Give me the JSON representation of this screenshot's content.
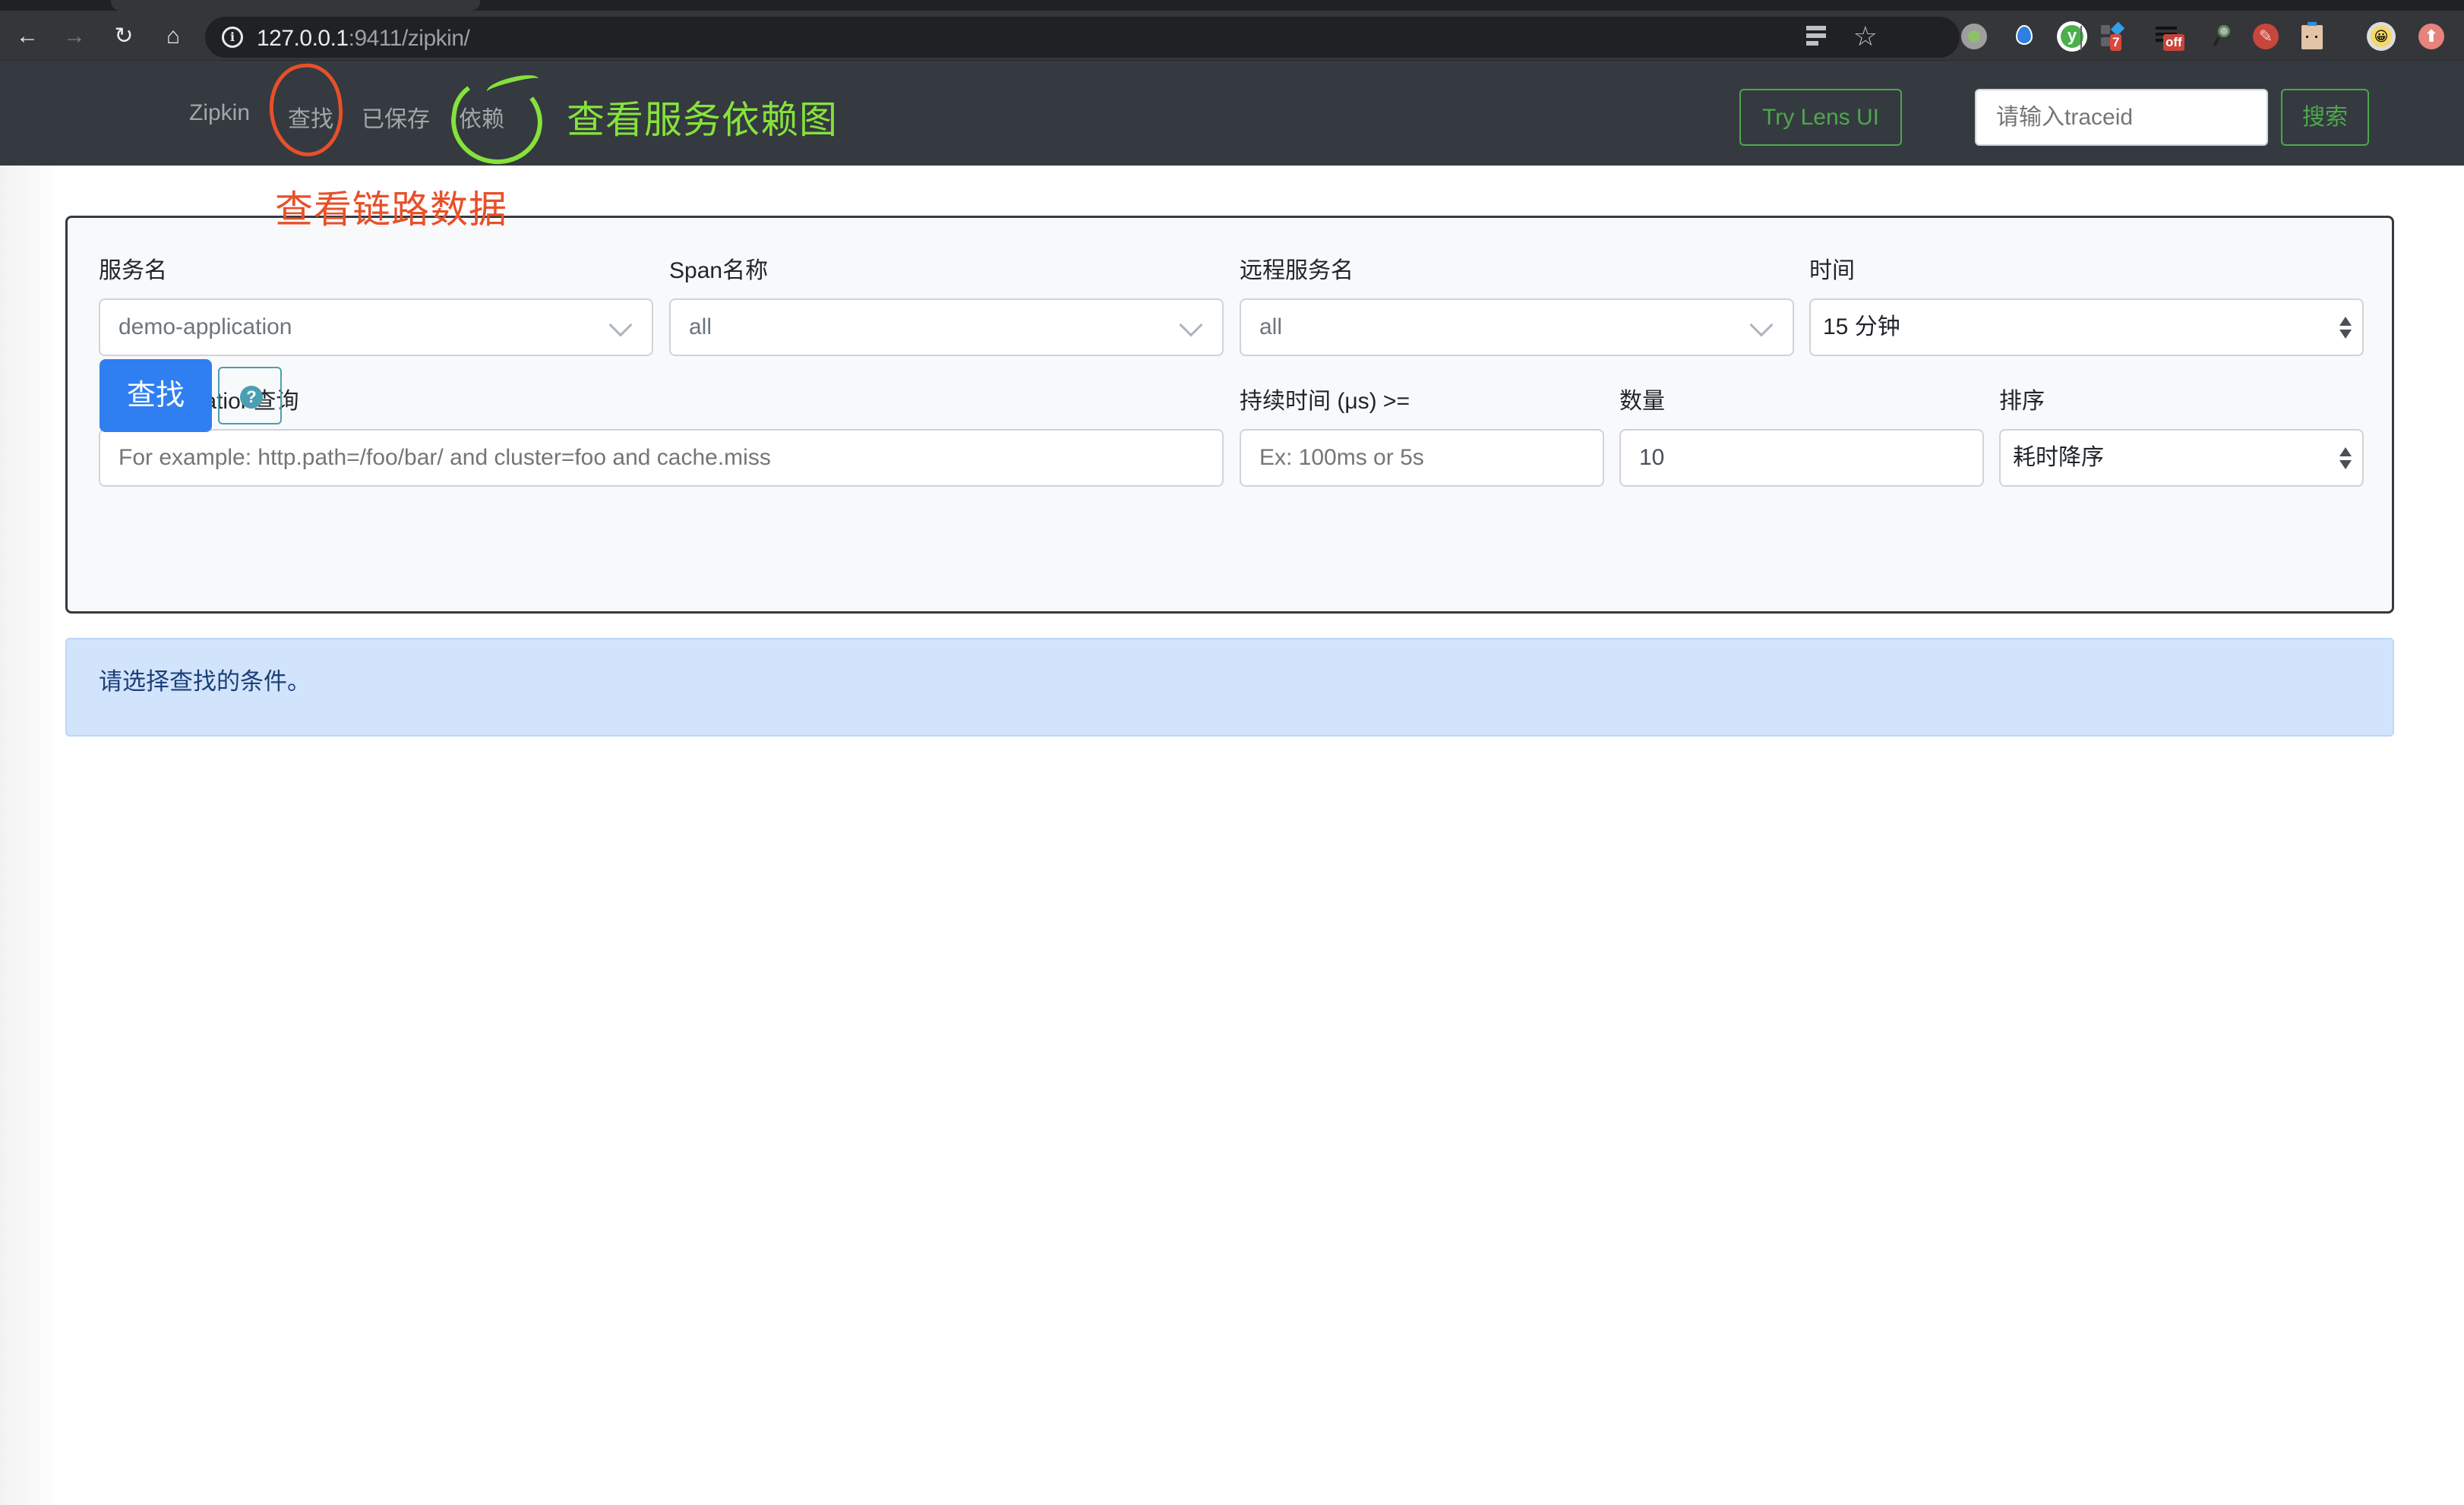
{
  "browser": {
    "url_host": "127.0.0.1",
    "url_rest": ":9411/zipkin/",
    "icons": [
      "back-arrow-icon",
      "forward-arrow-icon",
      "reload-icon",
      "home-icon",
      "site-info-icon",
      "reader-mode-icon",
      "bookmark-star-icon"
    ],
    "extensions": [
      {
        "name": "green-dot-extension",
        "color": "#8fbf6a"
      },
      {
        "name": "blue-diamond-extension",
        "color": "#2f7fe0"
      },
      {
        "name": "y-extension",
        "color": "#4bb04a",
        "glyph": "y"
      },
      {
        "name": "tiles-extension",
        "badge": "7"
      },
      {
        "name": "list-extension",
        "badge": "off"
      },
      {
        "name": "magnifier-extension"
      },
      {
        "name": "plug-extension",
        "color": "#c9463d"
      },
      {
        "name": "paper-bag-extension"
      },
      {
        "name": "smiley-extension"
      },
      {
        "name": "upload-extension",
        "color": "#e6837c"
      }
    ]
  },
  "navbar": {
    "brand": "Zipkin",
    "links": [
      "查找",
      "已保存",
      "依赖"
    ],
    "try_lens_label": "Try Lens UI",
    "traceid_placeholder": "请输入traceid",
    "search_label": "搜索"
  },
  "annotations": {
    "deps_note": "查看服务依赖图",
    "find_note": "查看链路数据",
    "colors": {
      "red": "#e8502a",
      "green": "#86e23b"
    }
  },
  "form": {
    "service_name": {
      "label": "服务名",
      "value": "demo-application"
    },
    "span_name": {
      "label": "Span名称",
      "value": "all"
    },
    "remote_service": {
      "label": "远程服务名",
      "value": "all"
    },
    "time": {
      "label": "时间",
      "value": "15 分钟"
    },
    "annotation_query": {
      "label": "根据Annotation查询",
      "placeholder": "For example: http.path=/foo/bar/ and cluster=foo and cache.miss"
    },
    "duration": {
      "label": "持续时间 (μs) >=",
      "placeholder": "Ex: 100ms or 5s"
    },
    "limit": {
      "label": "数量",
      "value": "10"
    },
    "sort": {
      "label": "排序",
      "value": "耗时降序"
    },
    "find_button": "查找",
    "help_icon": "question-circle-icon"
  },
  "alert": {
    "message": "请选择查找的条件。"
  },
  "colors": {
    "navbar_bg": "#343a40",
    "primary": "#307ff1",
    "outline_green": "#4fa64e",
    "alert_bg": "#d1e4fb",
    "info": "#4b9fb3"
  }
}
